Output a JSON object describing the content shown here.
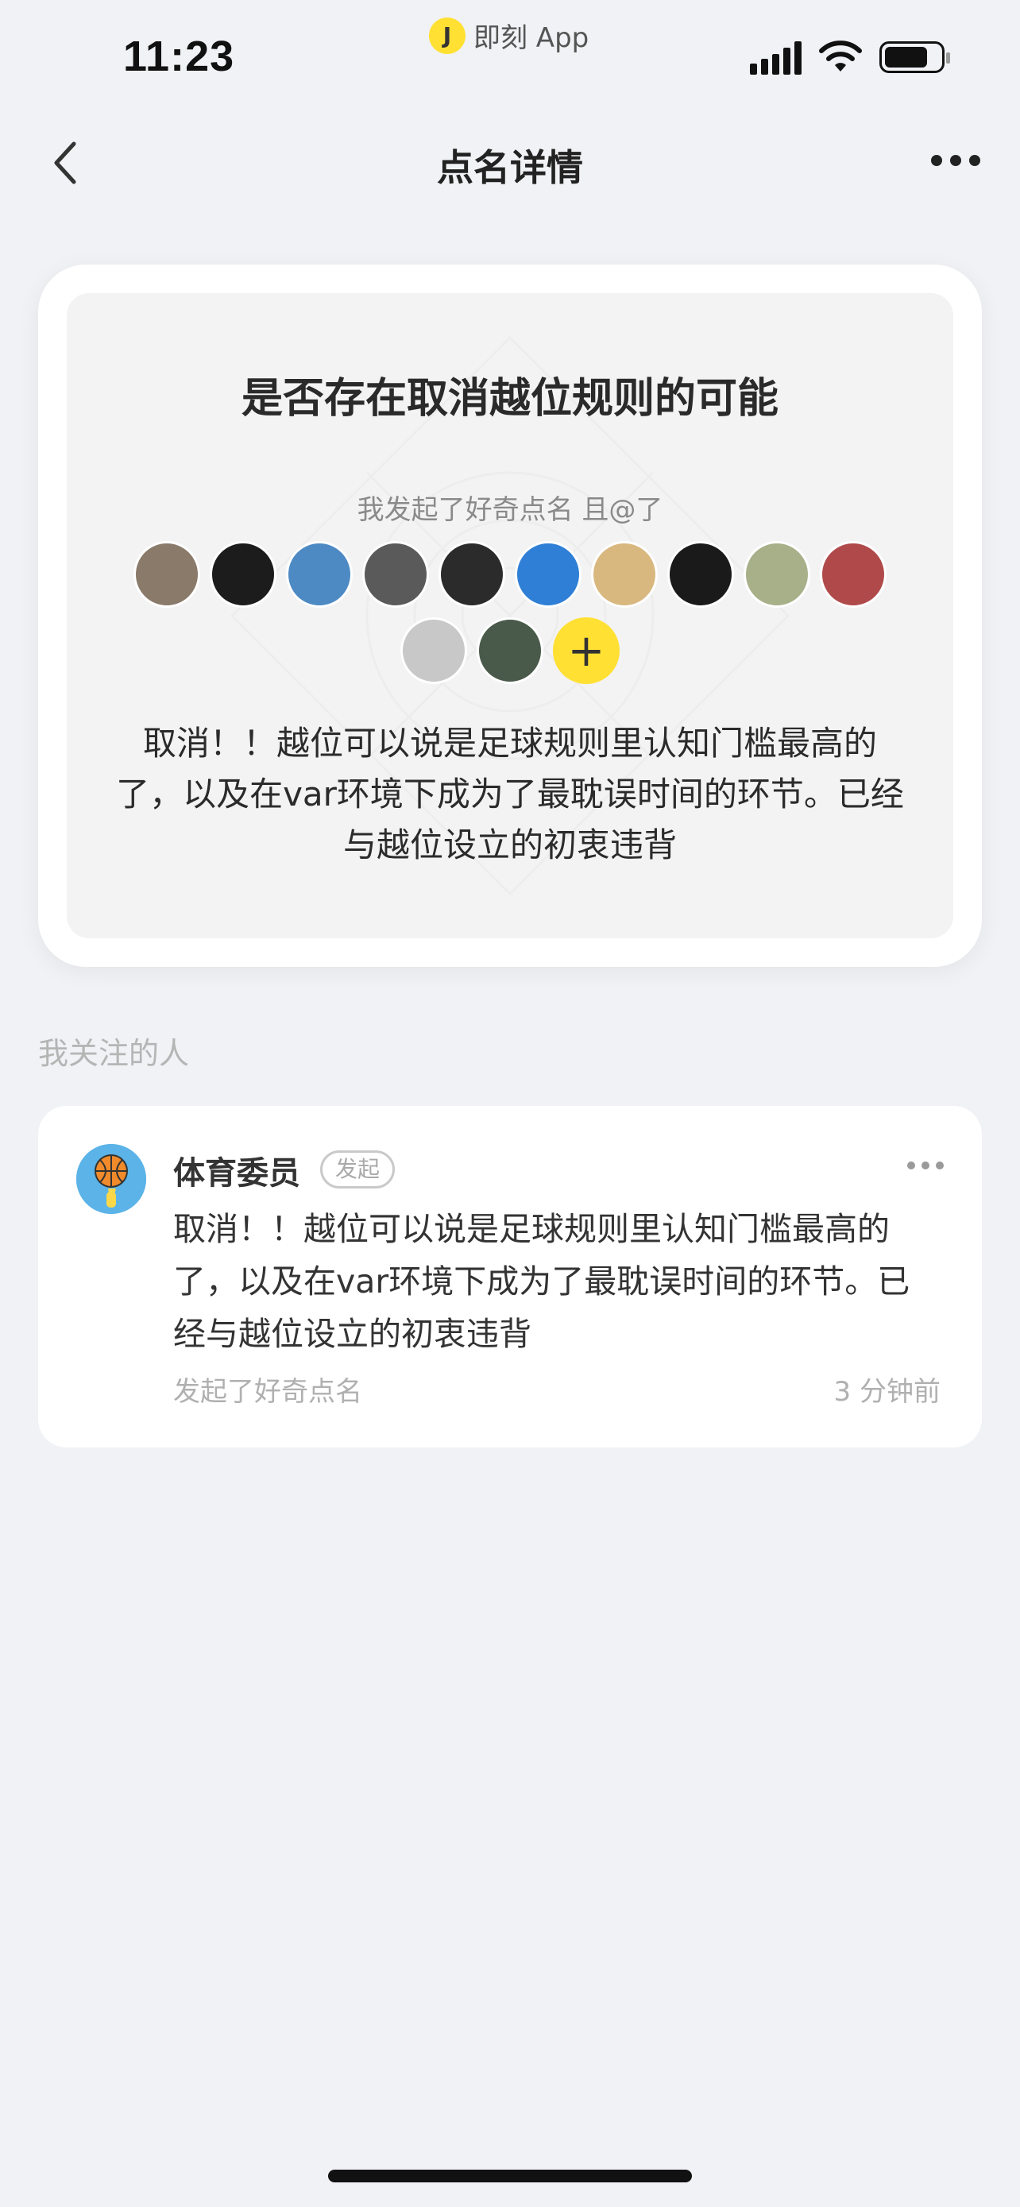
{
  "status_bar": {
    "time": "11:23",
    "app_icon_glyph": "J",
    "app_label": "即刻 App",
    "icons": [
      "signal-icon",
      "wifi-icon",
      "battery-icon"
    ]
  },
  "nav": {
    "title": "点名详情",
    "back_icon": "chevron-left-icon",
    "more_icon": "more-icon"
  },
  "card": {
    "title": "是否存在取消越位规则的可能",
    "subtitle": "我发起了好奇点名 且@了",
    "mentioned_avatars_row1": [
      "#8a7a6a",
      "#1c1c1c",
      "#4d8ac4",
      "#5a5a5a",
      "#2b2b2b",
      "#2f7fd6",
      "#d9b880",
      "#1a1a1a",
      "#a8b08a",
      "#b04a4a"
    ],
    "mentioned_avatars_row2": [
      "#c8c8c8",
      "#4a5a4a"
    ],
    "add_label": "+",
    "body": "取消！！越位可以说是足球规则里认知门槛最高的了，以及在var环境下成为了最耽误时间的环节。已经与越位设立的初衷违背"
  },
  "section": {
    "label": "我关注的人"
  },
  "comment": {
    "user_name": "体育委员",
    "badge": "发起",
    "text": "取消！！越位可以说是足球规则里认知门槛最高的了，以及在var环境下成为了最耽误时间的环节。已经与越位设立的初衷违背",
    "action": "发起了好奇点名",
    "time": "3 分钟前"
  },
  "colors": {
    "accent": "#ffe033",
    "background": "#f1f2f5"
  }
}
